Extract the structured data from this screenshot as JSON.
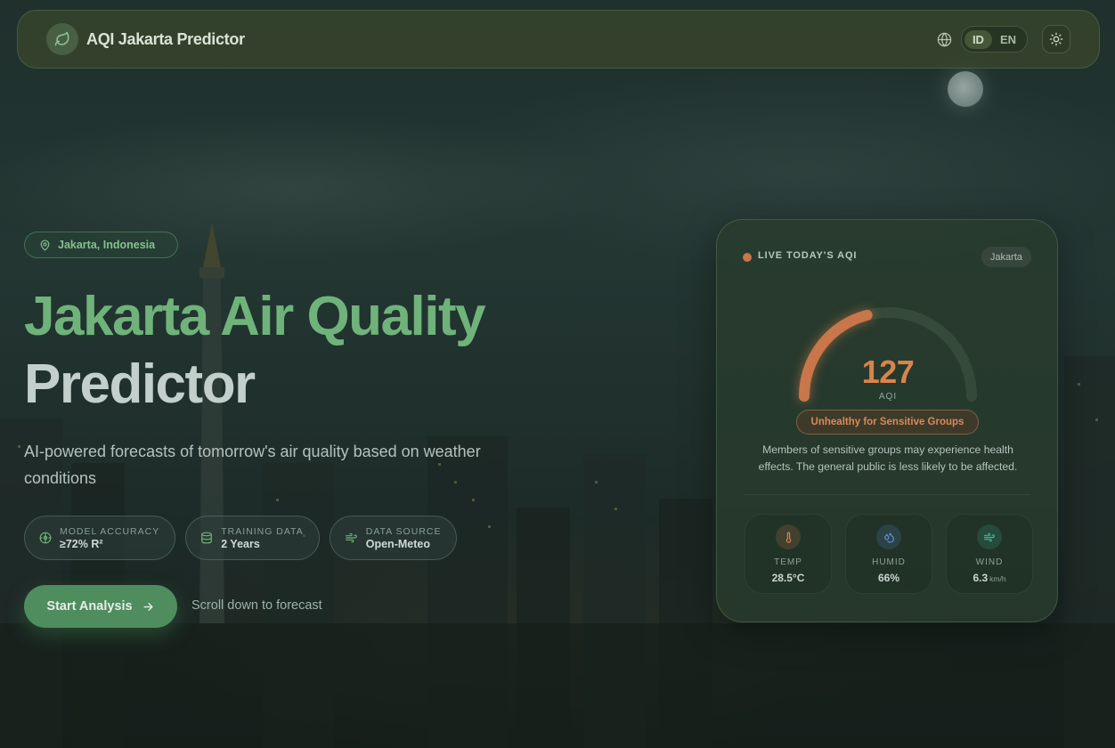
{
  "header": {
    "app_title": "AQI Jakarta Predictor",
    "languages": [
      {
        "code": "ID",
        "active": false
      },
      {
        "code": "EN",
        "active": true
      }
    ]
  },
  "hero": {
    "location": "Jakarta, Indonesia",
    "title_line1": "Jakarta Air Quality",
    "title_line2": "Predictor",
    "subtitle": "AI-powered forecasts of tomorrow's air quality based on weather conditions",
    "stats": [
      {
        "label": "MODEL ACCURACY",
        "value": "≥72% R²",
        "icon": "target-icon"
      },
      {
        "label": "TRAINING DATA",
        "value": "2 Years",
        "icon": "database-icon"
      },
      {
        "label": "DATA SOURCE",
        "value": "Open-Meteo",
        "icon": "wind-icon"
      }
    ],
    "start_button": "Start Analysis",
    "scroll_hint": "Scroll down to forecast"
  },
  "aqi_card": {
    "live_label": "LIVE TODAY'S AQI",
    "city": "Jakarta",
    "aqi_value": "127",
    "aqi_unit": "AQI",
    "category": "Unhealthy for Sensitive Groups",
    "description": "Members of sensitive groups may experience health effects. The general public is less likely to be affected.",
    "gauge_fraction": 0.42,
    "weather": [
      {
        "label": "TEMP",
        "value": "28.5°C",
        "unit": "",
        "icon": "thermometer-icon",
        "color": "#d9834c"
      },
      {
        "label": "HUMID",
        "value": "66%",
        "unit": "",
        "icon": "droplets-icon",
        "color": "#5b8fd6"
      },
      {
        "label": "WIND",
        "value": "6.3",
        "unit": "km/h",
        "icon": "wind-icon",
        "color": "#3fb89a"
      }
    ]
  },
  "colors": {
    "accent_green": "#6fb37a",
    "aqi_orange": "#d9834c"
  }
}
